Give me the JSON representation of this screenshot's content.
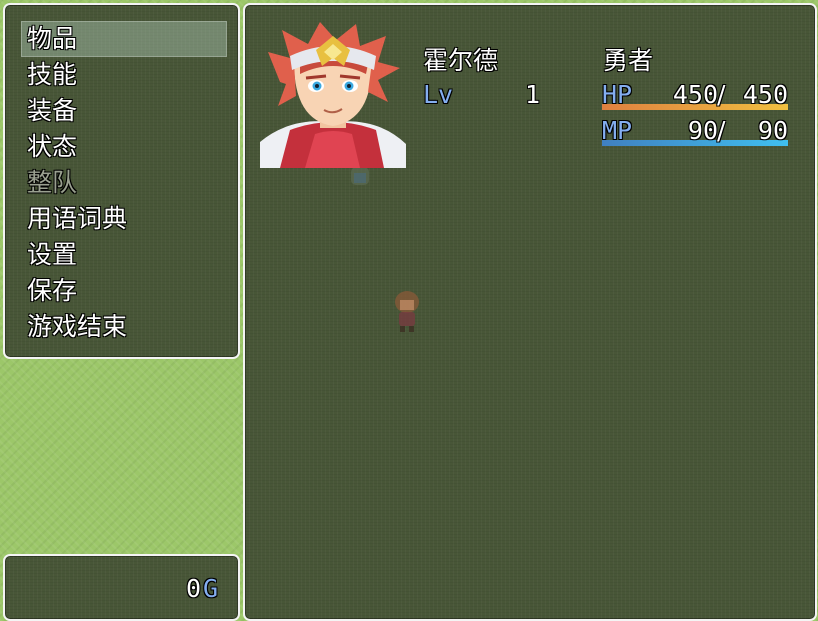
{
  "menu": {
    "items": [
      {
        "label": "物品",
        "selected": true,
        "enabled": true
      },
      {
        "label": "技能",
        "selected": false,
        "enabled": true
      },
      {
        "label": "装备",
        "selected": false,
        "enabled": true
      },
      {
        "label": "状态",
        "selected": false,
        "enabled": true
      },
      {
        "label": "整队",
        "selected": false,
        "enabled": false
      },
      {
        "label": "用语词典",
        "selected": false,
        "enabled": true
      },
      {
        "label": "设置",
        "selected": false,
        "enabled": true
      },
      {
        "label": "保存",
        "selected": false,
        "enabled": true
      },
      {
        "label": "游戏结束",
        "selected": false,
        "enabled": true
      }
    ]
  },
  "gold": {
    "amount": "0",
    "unit": "G"
  },
  "actor": {
    "name": "霍尔德",
    "class": "勇者",
    "level_label": "Lv",
    "level": "1",
    "hp_label": "HP",
    "hp": "450",
    "mhp": "450",
    "hp_rate": 1.0,
    "mp_label": "MP",
    "mp": "90",
    "mmp": "90",
    "mp_rate": 1.0
  },
  "colors": {
    "hp_gauge_1": "#e08040",
    "hp_gauge_2": "#f0c040",
    "mp_gauge_1": "#4080c0",
    "mp_gauge_2": "#40c0f0",
    "system_text": "#84aef0"
  }
}
